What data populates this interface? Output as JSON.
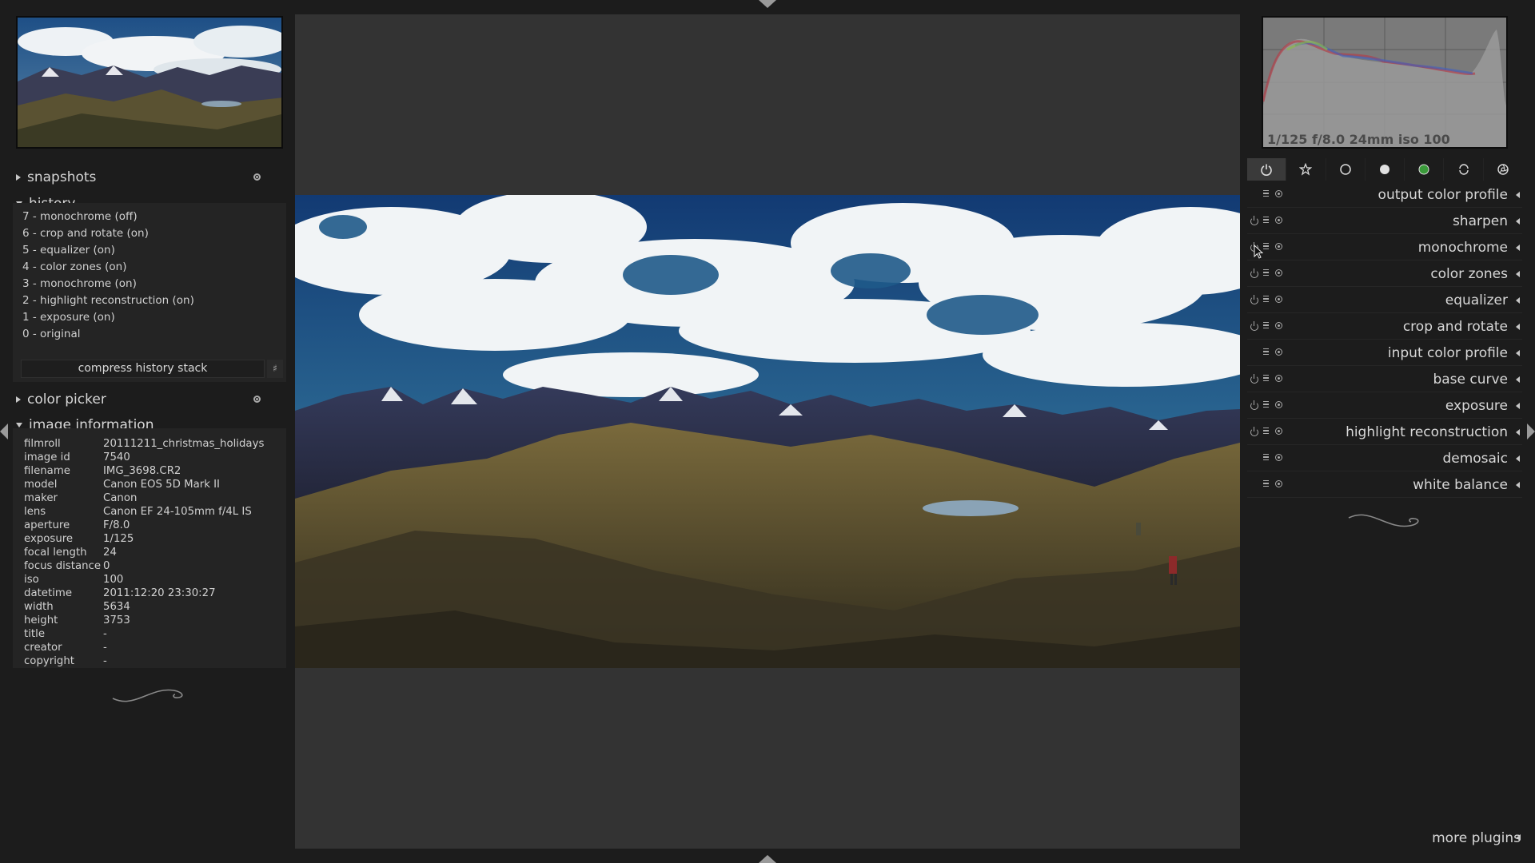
{
  "left_panel": {
    "sections": {
      "snapshots": "snapshots",
      "history": "history",
      "color_picker": "color picker",
      "image_information": "image information"
    },
    "history_items": [
      "7 - monochrome (off)",
      "6 - crop and rotate (on)",
      "5 - equalizer (on)",
      "4 - color zones (on)",
      "3 - monochrome (on)",
      "2 - highlight reconstruction (on)",
      "1 - exposure (on)",
      "0 - original"
    ],
    "compress_label": "compress history stack",
    "image_info": [
      {
        "key": "filmroll",
        "value": "20111211_christmas_holidays"
      },
      {
        "key": "image id",
        "value": "7540"
      },
      {
        "key": "filename",
        "value": "IMG_3698.CR2"
      },
      {
        "key": "model",
        "value": "Canon EOS 5D Mark II"
      },
      {
        "key": "maker",
        "value": "Canon"
      },
      {
        "key": "lens",
        "value": "Canon EF 24-105mm f/4L IS"
      },
      {
        "key": "aperture",
        "value": "F/8.0"
      },
      {
        "key": "exposure",
        "value": "1/125"
      },
      {
        "key": "focal length",
        "value": "24"
      },
      {
        "key": "focus distance",
        "value": "0"
      },
      {
        "key": "iso",
        "value": "100"
      },
      {
        "key": "datetime",
        "value": "2011:12:20 23:30:27"
      },
      {
        "key": "width",
        "value": "5634"
      },
      {
        "key": "height",
        "value": "3753"
      },
      {
        "key": "title",
        "value": "-"
      },
      {
        "key": "creator",
        "value": "-"
      },
      {
        "key": "copyright",
        "value": "-"
      }
    ]
  },
  "right_panel": {
    "histogram_text": "1/125 f/8.0 24mm iso 100",
    "module_group_icons": [
      "power-icon",
      "star-icon",
      "circle-outline-icon",
      "circle-filled-icon",
      "color-circle-icon",
      "rotate-icon",
      "aperture-icon"
    ],
    "modules": [
      {
        "label": "output color profile",
        "power": false
      },
      {
        "label": "sharpen",
        "power": true
      },
      {
        "label": "monochrome",
        "power": true
      },
      {
        "label": "color zones",
        "power": true
      },
      {
        "label": "equalizer",
        "power": true
      },
      {
        "label": "crop and rotate",
        "power": true
      },
      {
        "label": "input color profile",
        "power": false
      },
      {
        "label": "base curve",
        "power": true
      },
      {
        "label": "exposure",
        "power": true
      },
      {
        "label": "highlight reconstruction",
        "power": true
      },
      {
        "label": "demosaic",
        "power": false
      },
      {
        "label": "white balance",
        "power": false
      }
    ],
    "more_plugins": "more plugins"
  },
  "colors": {
    "background": "#1c1c1c",
    "center": "#333333",
    "panel_box": "#242424"
  }
}
